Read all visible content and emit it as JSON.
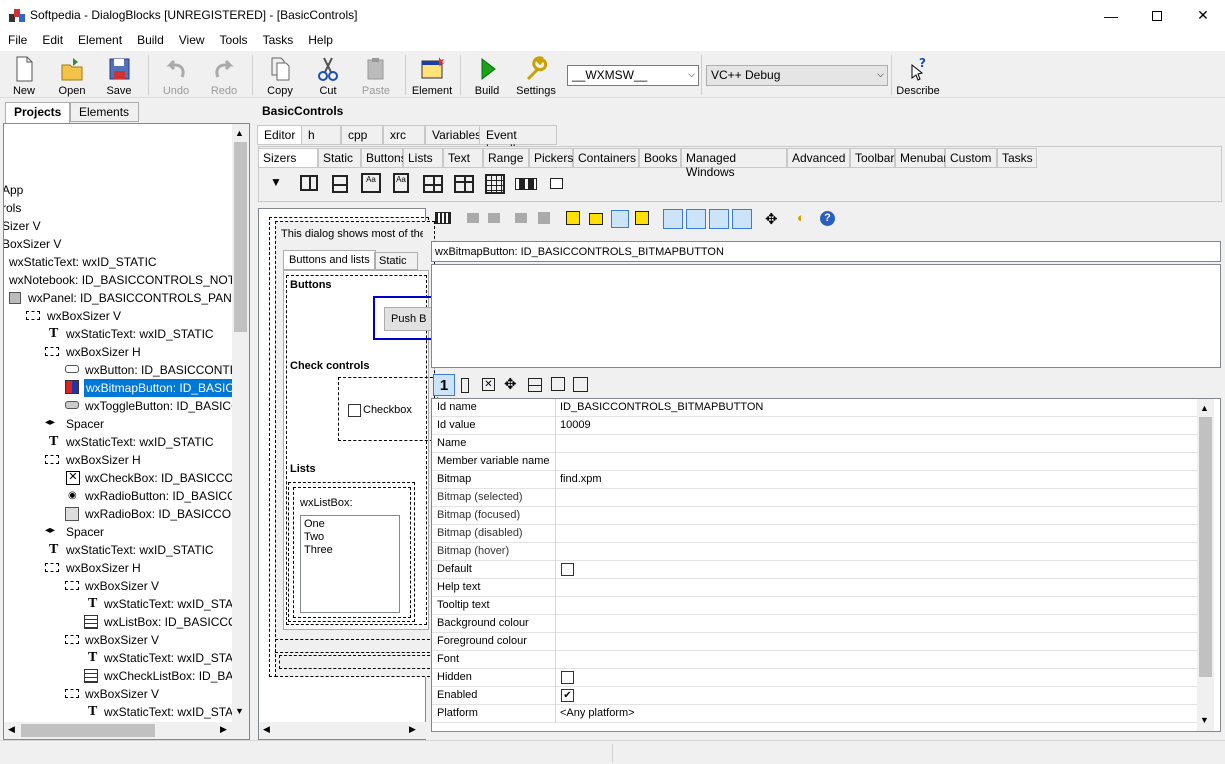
{
  "window": {
    "title": "Softpedia - DialogBlocks [UNREGISTERED] - [BasicControls]"
  },
  "menu": [
    "File",
    "Edit",
    "Element",
    "Build",
    "View",
    "Tools",
    "Tasks",
    "Help"
  ],
  "toolbar": {
    "new": "New",
    "open": "Open",
    "save": "Save",
    "undo": "Undo",
    "redo": "Redo",
    "copy": "Copy",
    "cut": "Cut",
    "paste": "Paste",
    "element": "Element",
    "build": "Build",
    "settings": "Settings",
    "describe": "Describe",
    "platform_combo": "__WXMSW__",
    "config_combo": "VC++ Debug"
  },
  "left_tabs": {
    "projects": "Projects",
    "elements": "Elements"
  },
  "tree": [
    "App",
    "rols",
    "Sizer V",
    "BoxSizer V",
    "wxStaticText: wxID_STATIC",
    "wxNotebook: ID_BASICCONTROLS_NOTEB",
    "wxPanel: ID_BASICCONTROLS_PANEL",
    "wxBoxSizer V",
    "wxStaticText: wxID_STATIC",
    "wxBoxSizer H",
    "wxButton: ID_BASICCONTRO",
    "wxBitmapButton: ID_BASICC",
    "wxToggleButton: ID_BASICC",
    "Spacer",
    "wxStaticText: wxID_STATIC",
    "wxBoxSizer H",
    "wxCheckBox: ID_BASICCON",
    "wxRadioButton: ID_BASICCO",
    "wxRadioBox: ID_BASICCONT",
    "Spacer",
    "wxStaticText: wxID_STATIC",
    "wxBoxSizer H",
    "wxBoxSizer V",
    "wxStaticText: wxID_STAT",
    "wxListBox: ID_BASICCONTI",
    "wxBoxSizer V",
    "wxStaticText: wxID_STAT",
    "wxCheckListBox: ID_BAS",
    "wxBoxSizer V",
    "wxStaticText: wxID_STAT"
  ],
  "doc": {
    "title": "BasicControls",
    "tabs1": [
      "Editor",
      "h",
      "cpp",
      "xrc",
      "Variables",
      "Event handlers"
    ],
    "tabs2": [
      "Sizers",
      "Static",
      "Buttons",
      "Lists",
      "Text",
      "Range",
      "Pickers",
      "Containers",
      "Books",
      "Managed Windows",
      "Advanced",
      "Toolbar",
      "Menubar",
      "Custom",
      "Tasks"
    ]
  },
  "canvas": {
    "intro": "This dialog shows most of the",
    "nb_tab1": "Buttons and lists",
    "nb_tab2": "Static",
    "buttons_label": "Buttons",
    "push_button": "Push B",
    "check_label": "Check controls",
    "checkbox": "Checkbox",
    "lists_label": "Lists",
    "listbox_label": "wxListBox:",
    "list_items": [
      "One",
      "Two",
      "Three"
    ]
  },
  "properties": {
    "element_title": "wxBitmapButton: ID_BASICCONTROLS_BITMAPBUTTON",
    "tab_number": "1",
    "rows": [
      {
        "k": "Id name",
        "v": "ID_BASICCONTROLS_BITMAPBUTTON"
      },
      {
        "k": "Id value",
        "v": "10009"
      },
      {
        "k": "Name",
        "v": ""
      },
      {
        "k": "Member variable name",
        "v": ""
      },
      {
        "k": "Bitmap",
        "v": "find.xpm"
      },
      {
        "k": "Bitmap (selected)",
        "v": ""
      },
      {
        "k": "Bitmap (focused)",
        "v": ""
      },
      {
        "k": "Bitmap (disabled)",
        "v": ""
      },
      {
        "k": "Bitmap (hover)",
        "v": ""
      },
      {
        "k": "Default",
        "v": ""
      },
      {
        "k": "Help text",
        "v": ""
      },
      {
        "k": "Tooltip text",
        "v": ""
      },
      {
        "k": "Background colour",
        "v": ""
      },
      {
        "k": "Foreground colour",
        "v": ""
      },
      {
        "k": "Font",
        "v": ""
      },
      {
        "k": "Hidden",
        "v": ""
      },
      {
        "k": "Enabled",
        "v": ""
      },
      {
        "k": "Platform",
        "v": "<Any platform>"
      }
    ]
  },
  "colors": {
    "selection": "#0078d7",
    "accent_blue": "#0000cc"
  }
}
